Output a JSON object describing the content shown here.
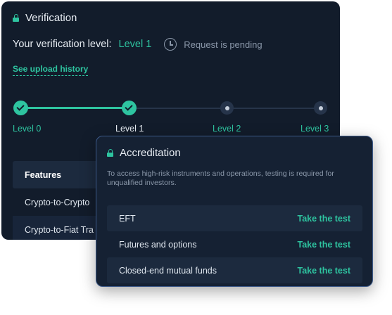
{
  "verification": {
    "title": "Verification",
    "level_label": "Your verification level:",
    "level_value": "Level 1",
    "status": "Request is pending",
    "history_link": "See upload history",
    "levels": [
      {
        "label": "Level 0",
        "state": "done"
      },
      {
        "label": "Level 1",
        "state": "done"
      },
      {
        "label": "Level 2",
        "state": "todo"
      },
      {
        "label": "Level 3",
        "state": "todo"
      }
    ],
    "table": {
      "header": "Features",
      "rows": [
        "Crypto-to-Crypto",
        "Crypto-to-Fiat Tra"
      ]
    }
  },
  "accreditation": {
    "title": "Accreditation",
    "description": "To access high-risk instruments and operations, testing is required for unqualified investors.",
    "items": [
      {
        "name": "EFT",
        "action": "Take the test"
      },
      {
        "name": "Futures and options",
        "action": "Take the test"
      },
      {
        "name": "Closed-end mutual funds",
        "action": "Take the test"
      }
    ]
  },
  "colors": {
    "accent": "#2ec4a0",
    "background": "#121c2b",
    "muted": "#8b98aa"
  },
  "icons": [
    "lock-icon",
    "clock-icon",
    "check-icon"
  ]
}
